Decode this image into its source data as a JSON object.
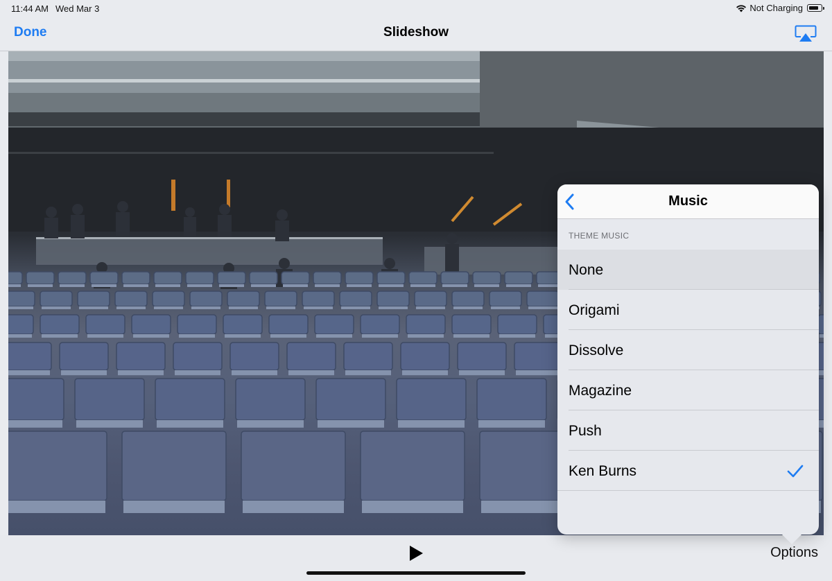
{
  "status_bar": {
    "time": "11:44 AM",
    "date": "Wed Mar 3",
    "charging_text": "Not Charging",
    "battery_level": 0.8
  },
  "nav": {
    "done_label": "Done",
    "title": "Slideshow",
    "airplay_icon": "airplay-icon"
  },
  "popover": {
    "title": "Music",
    "back_icon": "chevron-left-icon",
    "section_header": "THEME MUSIC",
    "selected": "Ken Burns",
    "items": [
      {
        "label": "None"
      },
      {
        "label": "Origami"
      },
      {
        "label": "Dissolve"
      },
      {
        "label": "Magazine"
      },
      {
        "label": "Push"
      },
      {
        "label": "Ken Burns"
      }
    ]
  },
  "toolbar": {
    "play_icon": "play-icon",
    "options_label": "Options"
  },
  "colors": {
    "accent": "#1e7cf2",
    "background": "#e9ebef"
  }
}
